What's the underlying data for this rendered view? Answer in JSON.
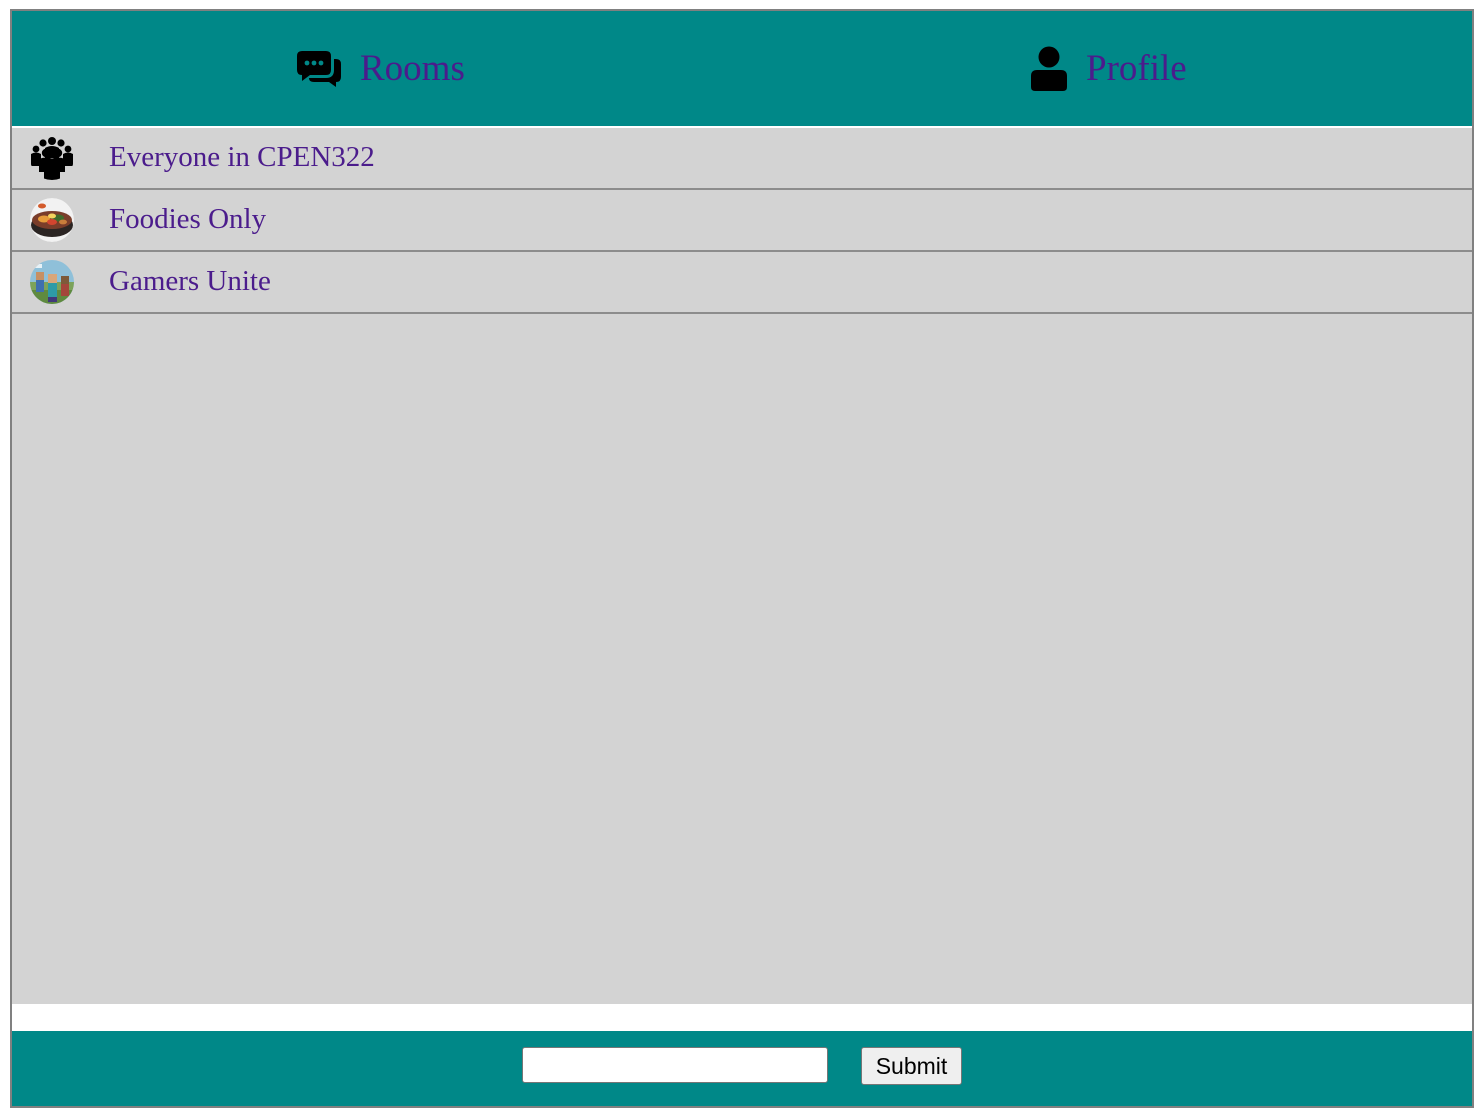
{
  "menu": {
    "rooms_label": "Rooms",
    "rooms_icon": "chat-bubbles-icon",
    "profile_label": "Profile",
    "profile_icon": "user-icon"
  },
  "rooms": [
    {
      "name": "Everyone in CPEN322",
      "icon": "group-people-icon"
    },
    {
      "name": "Foodies Only",
      "icon": "food-bowl-image"
    },
    {
      "name": "Gamers Unite",
      "icon": "game-characters-image"
    }
  ],
  "footer": {
    "input_value": "",
    "submit_label": "Submit"
  },
  "colors": {
    "header_bg": "#008888",
    "list_bg": "#d3d3d3",
    "link_text": "#4b1c8c"
  }
}
